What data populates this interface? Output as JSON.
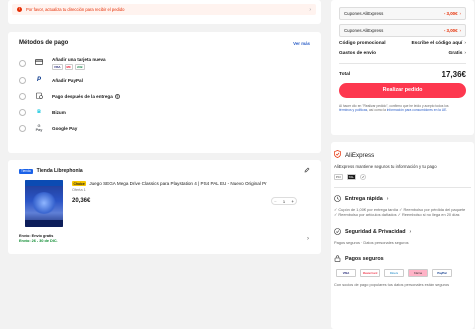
{
  "address_notice": {
    "text": "Por favor, actualiza tu dirección para recibir el pedido",
    "chevron": "chevron-right-icon"
  },
  "payment": {
    "title": "Métodos de pago",
    "see_more": "Ver más",
    "methods": [
      {
        "label": "Añadir una tarjeta nueva",
        "icon": "credit-card-icon",
        "brands": [
          "VISA",
          "MC",
          "JCB"
        ]
      },
      {
        "label": "Añadir PayPal",
        "icon": "paypal-icon"
      },
      {
        "label": "Pago después de la entrega",
        "icon": "delivery-pay-icon",
        "help": "?"
      },
      {
        "label": "Bizum",
        "icon": "bizum-icon"
      },
      {
        "label": "Google Pay",
        "icon": "google-pay-icon"
      }
    ]
  },
  "store": {
    "badge": "Tienda",
    "name": "Tienda Librephonia",
    "product": {
      "tag": "Choice",
      "title": "Juego SEGA Mega Drive Classics para Playstation 4 | PS4 PAL EU - Nuevo Original Pr",
      "variant": "Oferta 1",
      "price": "20,36€",
      "quantity": "1",
      "minus": "−",
      "plus": "+"
    },
    "shipping": {
      "label": "Envío: Envío gratis",
      "date": "Envío: 26 - 30 de DIC."
    }
  },
  "summary": {
    "coupons": [
      {
        "label": "Cupones AliExpress",
        "value": "- 3,00€",
        "chevron": "›"
      },
      {
        "label": "Cupones AliExpress",
        "value": "- 3,00€",
        "chevron": "›"
      }
    ],
    "promo_label": "Código promocional",
    "promo_value": "Escribe el código aquí",
    "shipping_label": "Gastos de envío",
    "shipping_value": "Gratis",
    "total_label": "Total",
    "total_value": "17,36€",
    "cta": "Realizar pedido",
    "legal_1": "Al hacer clic en \"Realizar pedido\", confirmo que he leído y acepto todos los ",
    "legal_link_1": "términos y políticas",
    "legal_2": ", así como la ",
    "legal_link_2": "información para consumidores en la UE",
    "legal_3": "."
  },
  "trust": {
    "brand": "AliExpress",
    "tagline": "AliExpress mantiene seguros tu información y tu pago",
    "cert_badges": [
      "PCI",
      "SSL",
      "✔"
    ],
    "fast_title": "Entrega rápida",
    "fast_text": "✓ Cupón de 1,00€ por entrega tardía  ✓ Reembolso por pérdida del paquete  ✓ Reembolso por artículos dañados  ✓ Reembolso si no llega en 20 días",
    "security_title": "Seguridad & Privacidad",
    "security_text": "Pagos seguros · Datos personales seguros",
    "payments_title": "Pagos seguros",
    "pay_logos": [
      "VISA",
      "MasterCard",
      "Diners",
      "Klarna",
      "PayPal"
    ],
    "payments_text": "Con socios de pago populares tus datos personales están seguros"
  },
  "colors": {
    "accent": "#fd384f",
    "price_red": "#e62e04",
    "link_blue": "#2b5ec7",
    "green": "#0a8a2e"
  }
}
